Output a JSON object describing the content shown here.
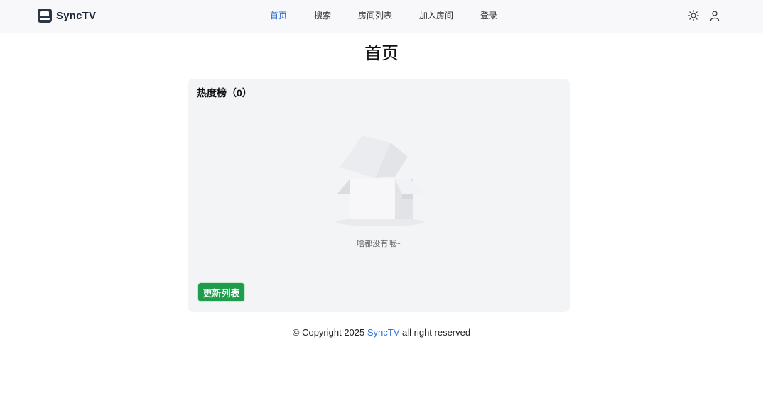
{
  "brand": {
    "name": "SyncTV",
    "logo_icon": "tv-logo-icon"
  },
  "nav": {
    "items": [
      {
        "label": "首页",
        "active": true
      },
      {
        "label": "搜索",
        "active": false
      },
      {
        "label": "房间列表",
        "active": false
      },
      {
        "label": "加入房间",
        "active": false
      },
      {
        "label": "登录",
        "active": false
      }
    ],
    "right_icons": [
      "sun-icon",
      "user-icon"
    ]
  },
  "page": {
    "title": "首页"
  },
  "hot_list": {
    "header": "热度榜（0）",
    "empty_text": "啥都没有哦~",
    "refresh_label": "更新列表",
    "empty_icon": "empty-box-icon"
  },
  "footer": {
    "prefix": "© Copyright 2025 ",
    "link": "SyncTV",
    "suffix": " all right reserved"
  },
  "colors": {
    "accent": "#2f6fd6",
    "button": "#1f9d4c",
    "card_bg": "#f3f4f6",
    "navbar_bg": "#f8f8fa"
  }
}
